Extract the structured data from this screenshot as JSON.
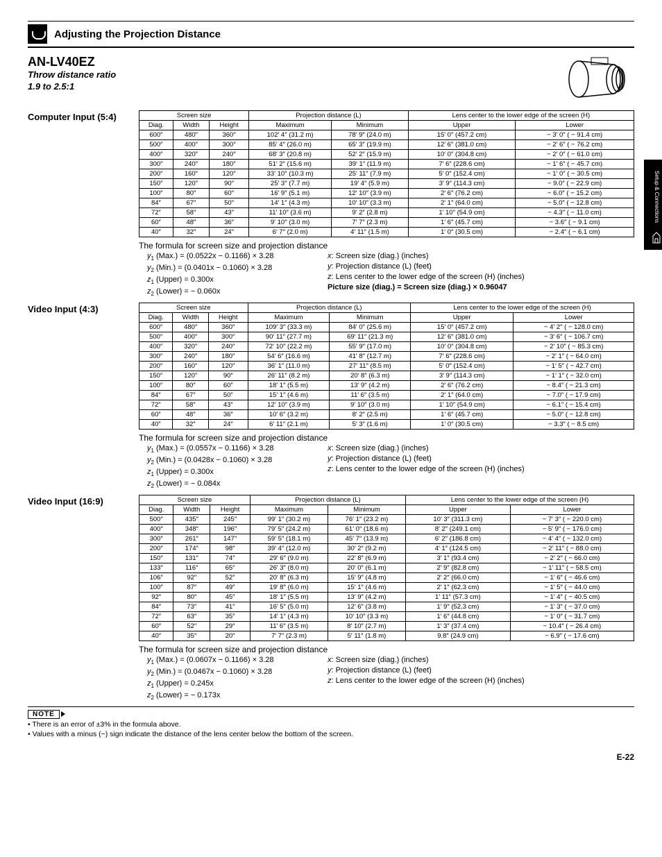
{
  "header": {
    "title": "Adjusting the Projection Distance"
  },
  "sideTab": "Setup & Connections",
  "pageNum": "E-22",
  "model": {
    "name": "AN-LV40EZ",
    "ratioLabel": "Throw distance ratio",
    "ratioValue": "1.9 to 2.5:1"
  },
  "tableHeaders": {
    "screenSize": "Screen size",
    "diag": "Diag.",
    "width": "Width",
    "height": "Height",
    "projDist": "Projection distance (L)",
    "max": "Maximum",
    "min": "Minimum",
    "lensCenter": "Lens center to the lower edge of the screen (H)",
    "upper": "Upper",
    "lower": "Lower"
  },
  "sections": [
    {
      "label": "Computer Input (5:4)",
      "rows": [
        [
          "600″",
          "480″",
          "360″",
          "102′ 4″ (31.2 m)",
          "78′ 9″ (24.0 m)",
          "15′ 0″ (457.2 cm)",
          "− 3′ 0″ ( − 91.4 cm)"
        ],
        [
          "500″",
          "400″",
          "300″",
          "85′ 4″ (26.0 m)",
          "65′ 3″ (19.9 m)",
          "12′ 6″ (381.0 cm)",
          "− 2′ 6″ ( − 76.2 cm)"
        ],
        [
          "400″",
          "320″",
          "240″",
          "68′ 3″ (20.8 m)",
          "52′ 2″ (15.9 m)",
          "10′ 0″ (304.8 cm)",
          "− 2′ 0″ ( − 61.0 cm)"
        ],
        [
          "300″",
          "240″",
          "180″",
          "51′ 2″ (15.6 m)",
          "39′ 1″ (11.9 m)",
          "7′ 6″ (228.6 cm)",
          "− 1′ 6″ ( − 45.7 cm)"
        ],
        [
          "200″",
          "160″",
          "120″",
          "33′ 10″ (10.3 m)",
          "25′ 11″ (7.9 m)",
          "5′ 0″ (152.4 cm)",
          "− 1′ 0″ ( − 30.5 cm)"
        ],
        [
          "150″",
          "120″",
          "90″",
          "25′ 3″ (7.7 m)",
          "19′ 4″ (5.9 m)",
          "3′ 9″ (114.3 cm)",
          "− 9.0″ ( − 22.9 cm)"
        ],
        [
          "100″",
          "80″",
          "60″",
          "16′ 9″ (5.1 m)",
          "12′ 10″ (3.9 m)",
          "2′ 6″ (76.2 cm)",
          "− 6.0″ ( − 15.2 cm)"
        ],
        [
          "84″",
          "67″",
          "50″",
          "14′ 1″ (4.3 m)",
          "10′ 10″ (3.3 m)",
          "2′ 1″ (64.0 cm)",
          "− 5.0″ ( − 12.8 cm)"
        ],
        [
          "72″",
          "58″",
          "43″",
          "11′ 10″ (3.6 m)",
          "9′ 2″ (2.8 m)",
          "1′ 10″ (54.9 cm)",
          "− 4.3″ ( − 11.0 cm)"
        ],
        [
          "60″",
          "48″",
          "36″",
          "9′ 10″ (3.0 m)",
          "7′ 7″ (2.3 m)",
          "1′ 6″ (45.7 cm)",
          "− 3.6″ ( − 9.1 cm)"
        ],
        [
          "40″",
          "32″",
          "24″",
          "6′ 7″ (2.0 m)",
          "4′ 11″ (1.5 m)",
          "1′ 0″ (30.5 cm)",
          "− 2.4″ ( − 6.1 cm)"
        ]
      ],
      "formula": {
        "y1": "(Max.) = (0.0522x − 0.1166) × 3.28",
        "y2": "(Min.) = (0.0401x − 0.1060) × 3.28",
        "z1": "(Upper) = 0.300x",
        "z2": "(Lower) = − 0.060x",
        "pic": "Picture size (diag.) = Screen size (diag.) × 0.96047"
      }
    },
    {
      "label": "Video Input (4:3)",
      "rows": [
        [
          "600″",
          "480″",
          "360″",
          "109′ 3″ (33.3 m)",
          "84′ 0″ (25.6 m)",
          "15′ 0″ (457.2 cm)",
          "− 4′ 2″ ( − 128.0 cm)"
        ],
        [
          "500″",
          "400″",
          "300″",
          "90′ 11″ (27.7 m)",
          "69′ 11″ (21.3 m)",
          "12′ 6″ (381.0 cm)",
          "− 3′ 6″ ( − 106.7 cm)"
        ],
        [
          "400″",
          "320″",
          "240″",
          "72′ 10″ (22.2 m)",
          "55′ 9″ (17.0 m)",
          "10′ 0″ (304.8 cm)",
          "− 2′ 10″ ( − 85.3 cm)"
        ],
        [
          "300″",
          "240″",
          "180″",
          "54′ 6″ (16.6 m)",
          "41′ 8″ (12.7 m)",
          "7′ 6″ (228.6 cm)",
          "− 2′ 1″ ( − 64.0 cm)"
        ],
        [
          "200″",
          "160″",
          "120″",
          "36′ 1″ (11.0 m)",
          "27′ 11″ (8.5 m)",
          "5′ 0″ (152.4 cm)",
          "− 1′ 5″ ( − 42.7 cm)"
        ],
        [
          "150″",
          "120″",
          "90″",
          "26′ 11″ (8.2 m)",
          "20′ 8″ (6.3 m)",
          "3′ 9″ (114.3 cm)",
          "− 1′ 1″ ( − 32.0 cm)"
        ],
        [
          "100″",
          "80″",
          "60″",
          "18′ 1″ (5.5 m)",
          "13′ 9″ (4.2 m)",
          "2′ 6″ (76.2 cm)",
          "− 8.4″ ( − 21.3 cm)"
        ],
        [
          "84″",
          "67″",
          "50″",
          "15′ 1″ (4.6 m)",
          "11′ 6″ (3.5 m)",
          "2′ 1″ (64.0 cm)",
          "− 7.0″ ( − 17.9 cm)"
        ],
        [
          "72″",
          "58″",
          "43″",
          "12′ 10″ (3.9 m)",
          "9′ 10″ (3.0 m)",
          "1′ 10″ (54.9 cm)",
          "− 6.1″ ( − 15.4 cm)"
        ],
        [
          "60″",
          "48″",
          "36″",
          "10′ 6″ (3.2 m)",
          "8′ 2″ (2.5 m)",
          "1′ 6″ (45.7 cm)",
          "− 5.0″ ( − 12.8 cm)"
        ],
        [
          "40″",
          "32″",
          "24″",
          "6′ 11″ (2.1 m)",
          "5′ 3″ (1.6 m)",
          "1′ 0″ (30.5 cm)",
          "− 3.3″ ( − 8.5 cm)"
        ]
      ],
      "formula": {
        "y1": "(Max.) = (0.0557x − 0.1166) × 3.28",
        "y2": "(Min.) = (0.0428x − 0.1060) × 3.28",
        "z1": "(Upper) = 0.300x",
        "z2": "(Lower) = − 0.084x",
        "pic": ""
      }
    },
    {
      "label": "Video Input (16:9)",
      "rows": [
        [
          "500″",
          "435″",
          "245″",
          "99′ 1″ (30.2 m)",
          "76′ 1″ (23.2 m)",
          "10′ 3″ (311.3 cm)",
          "− 7′ 3″ ( − 220.0 cm)"
        ],
        [
          "400″",
          "348″",
          "196″",
          "79′ 5″ (24.2 m)",
          "61′ 0″ (18.6 m)",
          "8′ 2″ (249.1 cm)",
          "− 5′ 9″ ( − 176.0 cm)"
        ],
        [
          "300″",
          "261″",
          "147″",
          "59′ 5″ (18.1 m)",
          "45′ 7″ (13.9 m)",
          "6′ 2″ (186.8 cm)",
          "− 4′ 4″ ( − 132.0 cm)"
        ],
        [
          "200″",
          "174″",
          "98″",
          "39′ 4″ (12.0 m)",
          "30′ 2″ (9.2 m)",
          "4′ 1″ (124.5 cm)",
          "− 2′ 11″ ( − 88.0 cm)"
        ],
        [
          "150″",
          "131″",
          "74″",
          "29′ 6″ (9.0 m)",
          "22′ 8″ (6.9 m)",
          "3′ 1″ (93.4 cm)",
          "− 2′ 2″ ( − 66.0 cm)"
        ],
        [
          "133″",
          "116″",
          "65″",
          "26′ 3″ (8.0 m)",
          "20′ 0″ (6.1 m)",
          "2′ 9″ (82.8 cm)",
          "− 1′ 11″ ( − 58.5 cm)"
        ],
        [
          "106″",
          "92″",
          "52″",
          "20′ 8″ (6.3 m)",
          "15′ 9″ (4.8 m)",
          "2′ 2″ (66.0 cm)",
          "− 1′ 6″ ( − 46.6 cm)"
        ],
        [
          "100″",
          "87″",
          "49″",
          "19′ 8″ (6.0 m)",
          "15′ 1″ (4.6 m)",
          "2′ 1″ (62.3 cm)",
          "− 1′ 5″ ( − 44.0 cm)"
        ],
        [
          "92″",
          "80″",
          "45″",
          "18′ 1″ (5.5 m)",
          "13′ 9″ (4.2 m)",
          "1′ 11″ (57.3 cm)",
          "− 1′ 4″ ( − 40.5 cm)"
        ],
        [
          "84″",
          "73″",
          "41″",
          "16′ 5″ (5.0 m)",
          "12′ 6″ (3.8 m)",
          "1′ 9″ (52.3 cm)",
          "− 1′ 3″ ( − 37.0 cm)"
        ],
        [
          "72″",
          "63″",
          "35″",
          "14′ 1″ (4.3 m)",
          "10′ 10″ (3.3 m)",
          "1′ 6″ (44.8 cm)",
          "− 1′ 0″ ( − 31.7 cm)"
        ],
        [
          "60″",
          "52″",
          "29″",
          "11′ 6″ (3.5 m)",
          "8′ 10″ (2.7 m)",
          "1′ 3″ (37.4 cm)",
          "− 10.4″ ( − 26.4 cm)"
        ],
        [
          "40″",
          "35″",
          "20″",
          "7′ 7″ (2.3 m)",
          "5′ 11″ (1.8 m)",
          "9.8″ (24.9 cm)",
          "− 6.9″ ( − 17.6 cm)"
        ]
      ],
      "formula": {
        "y1": "(Max.) = (0.0607x − 0.1166) × 3.28",
        "y2": "(Min.) = (0.0467x − 0.1060) × 3.28",
        "z1": "(Upper) = 0.245x",
        "z2": "(Lower) = − 0.173x",
        "pic": ""
      }
    }
  ],
  "formulaCommon": {
    "title": "The formula for screen size and projection distance",
    "x": "Screen size (diag.) (inches)",
    "y": "Projection distance (L) (feet)",
    "z": "Lens center to the lower edge of the screen (H) (inches)"
  },
  "notes": {
    "label": "NOTE",
    "n1": "There is an error of ±3% in the formula above.",
    "n2": "Values with a minus (−) sign indicate the distance of the lens center below the bottom of the screen."
  }
}
